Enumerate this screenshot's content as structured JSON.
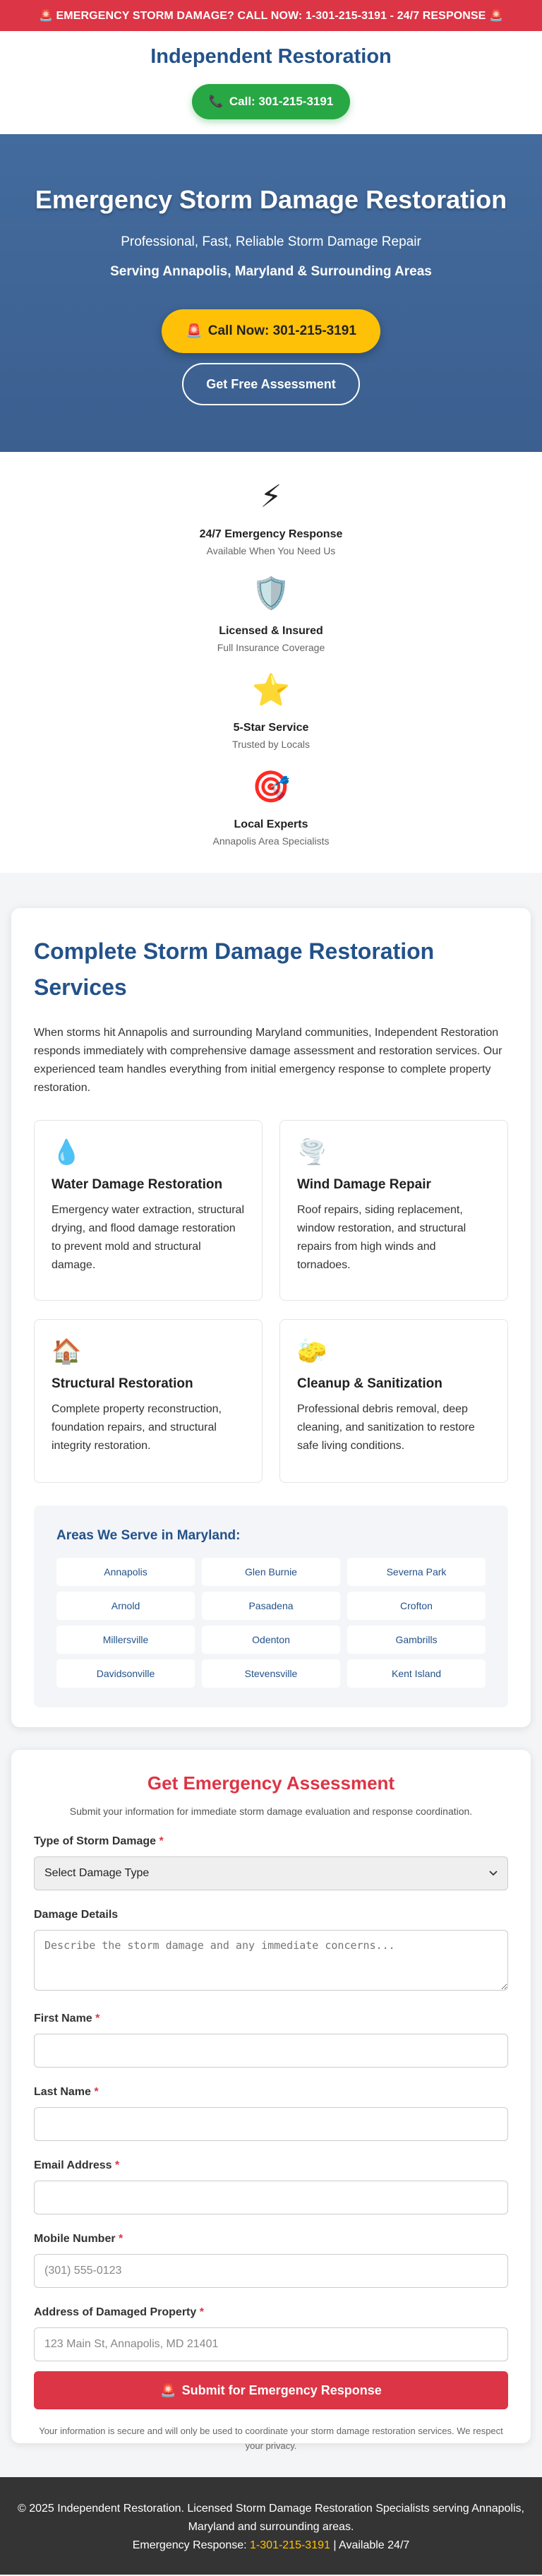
{
  "top_bar": {
    "text": "🚨 EMERGENCY STORM DAMAGE? CALL NOW: 1-301-215-3191 - 24/7 RESPONSE 🚨"
  },
  "header": {
    "brand": "Independent Restoration",
    "call_icon": "phone-icon",
    "call_glyph": "📞",
    "call_label": "Call: 301-215-3191"
  },
  "hero": {
    "title": "Emergency Storm Damage Restoration",
    "subtitle": "Professional, Fast, Reliable Storm Damage Repair",
    "location": "Serving Annapolis, Maryland & Surrounding Areas",
    "cta_glyph": "🚨",
    "cta_label": "Call Now: 301-215-3191",
    "secondary_label": "Get Free Assessment"
  },
  "trust": [
    {
      "icon": "lightning-icon",
      "glyph": "⚡",
      "title": "24/7 Emergency Response",
      "sub": "Available When You Need Us"
    },
    {
      "icon": "shield-icon",
      "glyph": "🛡️",
      "title": "Licensed & Insured",
      "sub": "Full Insurance Coverage"
    },
    {
      "icon": "star-icon",
      "glyph": "⭐",
      "title": "5-Star Service",
      "sub": "Trusted by Locals"
    },
    {
      "icon": "target-icon",
      "glyph": "🎯",
      "title": "Local Experts",
      "sub": "Annapolis Area Specialists"
    }
  ],
  "services": {
    "title": "Complete Storm Damage Restoration Services",
    "intro": "When storms hit Annapolis and surrounding Maryland communities, Independent Restoration responds immediately with comprehensive damage assessment and restoration services. Our experienced team handles everything from initial emergency response to complete property restoration.",
    "items": [
      {
        "icon": "water-drop-icon",
        "glyph": "💧",
        "title": "Water Damage Restoration",
        "desc": "Emergency water extraction, structural drying, and flood damage restoration to prevent mold and structural damage."
      },
      {
        "icon": "tornado-icon",
        "glyph": "🌪️",
        "title": "Wind Damage Repair",
        "desc": "Roof repairs, siding replacement, window restoration, and structural repairs from high winds and tornadoes."
      },
      {
        "icon": "house-icon",
        "glyph": "🏠",
        "title": "Structural Restoration",
        "desc": "Complete property reconstruction, foundation repairs, and structural integrity restoration."
      },
      {
        "icon": "sponge-icon",
        "glyph": "🧽",
        "title": "Cleanup & Sanitization",
        "desc": "Professional debris removal, deep cleaning, and sanitization to restore safe living conditions."
      }
    ],
    "areas_title": "Areas We Serve in Maryland:",
    "areas": [
      "Annapolis",
      "Glen Burnie",
      "Severna Park",
      "Arnold",
      "Pasadena",
      "Crofton",
      "Millersville",
      "Odenton",
      "Gambrills",
      "Davidsonville",
      "Stevensville",
      "Kent Island"
    ]
  },
  "form": {
    "title": "Get Emergency Assessment",
    "note": "Submit your information for immediate storm damage evaluation and response coordination.",
    "damage_type_label": "Type of Storm Damage",
    "damage_type_value": "Select Damage Type",
    "details_label": "Damage Details",
    "details_placeholder": "Describe the storm damage and any immediate concerns...",
    "first_name_label": "First Name",
    "last_name_label": "Last Name",
    "email_label": "Email Address",
    "phone_label": "Mobile Number",
    "phone_placeholder": "(301) 555-0123",
    "address_label": "Address of Damaged Property",
    "address_placeholder": "123 Main St, Annapolis, MD 21401",
    "required_mark": "*",
    "submit_glyph": "🚨",
    "submit_label": "Submit for Emergency Response",
    "privacy": "Your information is secure and will only be used to coordinate your storm damage restoration services. We respect your privacy."
  },
  "footer": {
    "line1": "© 2025 Independent Restoration. Licensed Storm Damage Restoration Specialists serving Annapolis, Maryland and surrounding areas.",
    "emergency_prefix": "Emergency Response: ",
    "phone_link": "1-301-215-3191",
    "suffix": " | Available 24/7"
  },
  "colors": {
    "red": "#dc3545",
    "blue": "#23528a",
    "hero_blue": "#3f6394",
    "green": "#28a745",
    "yellow": "#ffc107",
    "footer": "#343434"
  }
}
